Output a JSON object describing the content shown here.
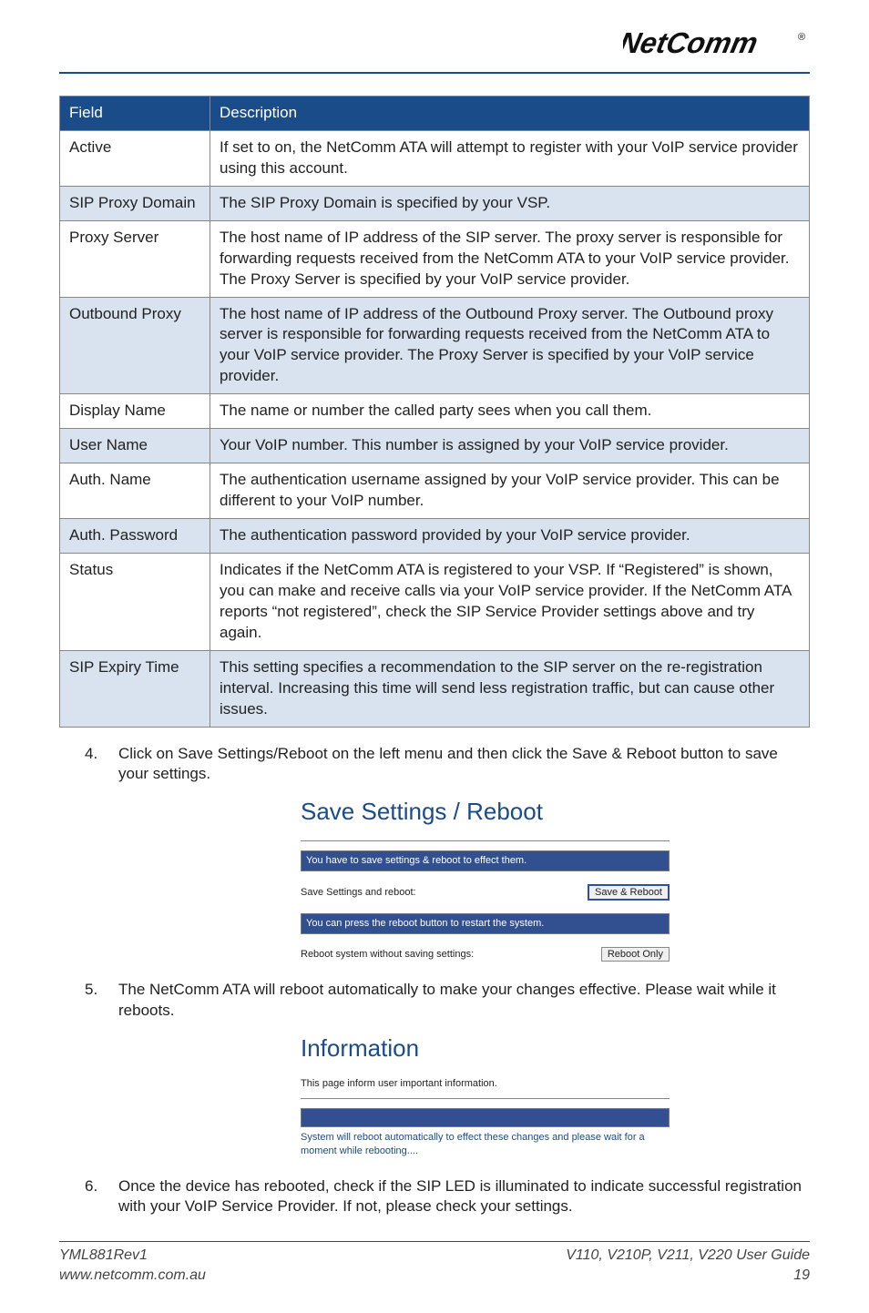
{
  "brand": {
    "name": "NetComm"
  },
  "table": {
    "header_field": "Field",
    "header_desc": "Description",
    "rows": [
      {
        "field": "Active",
        "desc": "If set to on, the NetComm ATA will attempt to register with your VoIP service provider using this account.",
        "shade": false
      },
      {
        "field": "SIP Proxy Domain",
        "desc": "The SIP Proxy Domain is specified by your VSP.",
        "shade": true
      },
      {
        "field": "Proxy Server",
        "desc": "The host name of IP address of the SIP server. The proxy server is responsible for forwarding requests received from the NetComm ATA to your VoIP service provider. The Proxy Server is specified by your VoIP service provider.",
        "shade": false
      },
      {
        "field": "Outbound Proxy",
        "desc": "The host name of IP address of the Outbound Proxy server. The Outbound proxy server is responsible for forwarding requests received from the NetComm ATA to your VoIP service provider. The Proxy Server is specified by your VoIP service provider.",
        "shade": true
      },
      {
        "field": "Display Name",
        "desc": "The name or number the called party sees when you call them.",
        "shade": false
      },
      {
        "field": "User Name",
        "desc": "Your VoIP number. This number is assigned by your VoIP service provider.",
        "shade": true
      },
      {
        "field": "Auth. Name",
        "desc": "The authentication username assigned by your VoIP service provider. This can be different to your VoIP number.",
        "shade": false
      },
      {
        "field": "Auth. Password",
        "desc": "The authentication password provided by your VoIP service provider.",
        "shade": true
      },
      {
        "field": "Status",
        "desc": "Indicates if the NetComm ATA is registered to your VSP. If “Registered” is shown, you can make and receive calls via your VoIP service provider. If the NetComm ATA reports “not registered”, check the SIP Service Provider settings above and try again.",
        "shade": false
      },
      {
        "field": "SIP Expiry Time",
        "desc": "This setting specifies a recommendation to the SIP server on the re-registration interval. Increasing this time will send less registration traffic, but can cause other issues.",
        "shade": true
      }
    ]
  },
  "steps": {
    "s4": "Click on Save Settings/Reboot on the left menu and then click the Save & Reboot button to save your settings.",
    "s5": "The NetComm ATA will reboot automatically to make your changes effective. Please wait while it reboots.",
    "s6": "Once the device has rebooted, check if the SIP LED is illuminated to indicate successful registration with your VoIP Service Provider. If not, please check your settings."
  },
  "ss1": {
    "title": "Save Settings / Reboot",
    "bar1": "You have to save settings & reboot to effect them.",
    "row1_label": "Save Settings and reboot:",
    "row1_btn": "Save & Reboot",
    "bar2": "You can press the reboot button to restart the system.",
    "row2_label": "Reboot system without saving settings:",
    "row2_btn": "Reboot Only"
  },
  "ss2": {
    "title": "Information",
    "sub": "This page inform user important information.",
    "msg": "System will reboot automatically to effect these changes and please wait for a moment while rebooting...."
  },
  "footer": {
    "left1": "YML881Rev1",
    "left2": "www.netcomm.com.au",
    "right1": "V110, V210P, V211, V220 User Guide",
    "right2": "19"
  }
}
